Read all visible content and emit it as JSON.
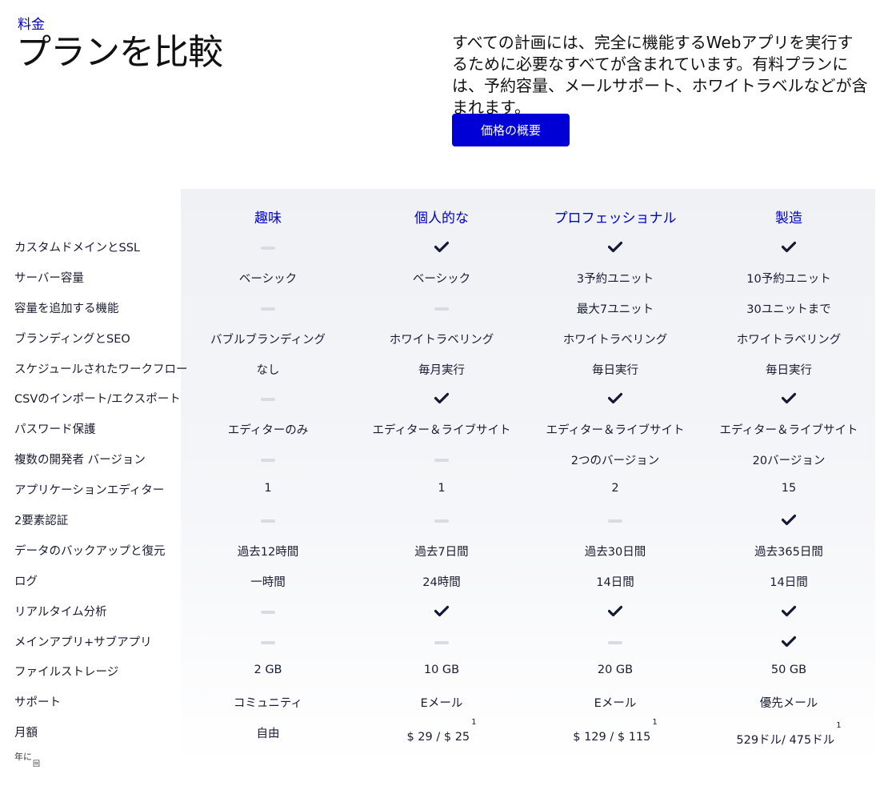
{
  "header": {
    "eyebrow": "料金",
    "title": "プランを比較",
    "intro": "すべての計画には、完全に機能するWebアプリを実行するために必要なすべてが含まれています。有料プランには、予約容量、メールサポート、ホワイトラベルなどが含まれます。",
    "button_label": "価格の概要"
  },
  "colors": {
    "accent": "#0000d6",
    "text": "#1a1c33",
    "dash": "#d9dbe2",
    "panel": "#eff1f5"
  },
  "plans": [
    "趣味",
    "個人的な",
    "プロフェッショナル",
    "製造"
  ],
  "rows": [
    {
      "label": "カスタムドメインとSSL",
      "cells": [
        {
          "dash": true
        },
        {
          "check": true
        },
        {
          "check": true
        },
        {
          "check": true
        }
      ]
    },
    {
      "label": "サーバー容量",
      "cells": [
        {
          "text": "ベーシック"
        },
        {
          "text": "ベーシック"
        },
        {
          "text": "3予約ユニット"
        },
        {
          "text": "10予約ユニット"
        }
      ]
    },
    {
      "label": "容量を追加する機能",
      "cells": [
        {
          "dash": true
        },
        {
          "dash": true
        },
        {
          "text": "最大7ユニット"
        },
        {
          "text": "30ユニットまで"
        }
      ]
    },
    {
      "label": "ブランディングとSEO",
      "cells": [
        {
          "text": "バブルブランディング"
        },
        {
          "text": "ホワイトラベリング"
        },
        {
          "text": "ホワイトラベリング"
        },
        {
          "text": "ホワイトラベリング"
        }
      ]
    },
    {
      "label": "スケジュールされたワークフロー",
      "cells": [
        {
          "text": "なし"
        },
        {
          "text": "毎月実行"
        },
        {
          "text": "毎日実行"
        },
        {
          "text": "毎日実行"
        }
      ]
    },
    {
      "label": "CSVのインポート/エクスポート",
      "cells": [
        {
          "dash": true
        },
        {
          "check": true
        },
        {
          "check": true
        },
        {
          "check": true
        }
      ]
    },
    {
      "label": "パスワード保護",
      "cells": [
        {
          "text": "エディターのみ"
        },
        {
          "text": "エディター＆ライブサイト"
        },
        {
          "text": "エディター＆ライブサイト"
        },
        {
          "text": "エディター＆ライブサイト"
        }
      ]
    },
    {
      "label": "複数の開発者 バージョン",
      "cells": [
        {
          "dash": true
        },
        {
          "dash": true
        },
        {
          "text": "2つのバージョン"
        },
        {
          "text": "20バージョン"
        }
      ]
    },
    {
      "label": "アプリケーションエディター",
      "cells": [
        {
          "text": "1"
        },
        {
          "text": "1"
        },
        {
          "text": "2"
        },
        {
          "text": "15"
        }
      ]
    },
    {
      "label": "2要素認証",
      "cells": [
        {
          "dash": true
        },
        {
          "dash": true
        },
        {
          "dash": true
        },
        {
          "check": true
        }
      ]
    },
    {
      "label": "データのバックアップと復元",
      "cells": [
        {
          "text": "過去12時間"
        },
        {
          "text": "過去7日間"
        },
        {
          "text": "過去30日間"
        },
        {
          "text": "過去365日間"
        }
      ]
    },
    {
      "label": "ログ",
      "cells": [
        {
          "text": "一時間"
        },
        {
          "text": "24時間"
        },
        {
          "text": "14日間"
        },
        {
          "text": "14日間"
        }
      ]
    },
    {
      "label": "リアルタイム分析",
      "cells": [
        {
          "dash": true
        },
        {
          "check": true
        },
        {
          "check": true
        },
        {
          "check": true
        }
      ]
    },
    {
      "label": "メインアプリ+サブアプリ",
      "cells": [
        {
          "dash": true
        },
        {
          "dash": true
        },
        {
          "dash": true
        },
        {
          "check": true
        }
      ]
    },
    {
      "label": "ファイルストレージ",
      "cells": [
        {
          "text": "2 GB"
        },
        {
          "text": "10 GB"
        },
        {
          "text": "20 GB"
        },
        {
          "text": "50 GB"
        }
      ]
    },
    {
      "label": "サポート",
      "cells": [
        {
          "text": "コミュニティ"
        },
        {
          "text": "Eメール"
        },
        {
          "text": "Eメール"
        },
        {
          "text": "優先メール"
        }
      ]
    },
    {
      "label": "月額",
      "cells": [
        {
          "text": "自由"
        },
        {
          "text": "$ 29 / $ 25",
          "sup": "1"
        },
        {
          "text": "$ 129 / $ 115",
          "sup": "1"
        },
        {
          "text": "529ドル/ 475ドル",
          "sup": "1"
        }
      ]
    }
  ],
  "footnote": {
    "text": "年に",
    "sub": "回"
  }
}
